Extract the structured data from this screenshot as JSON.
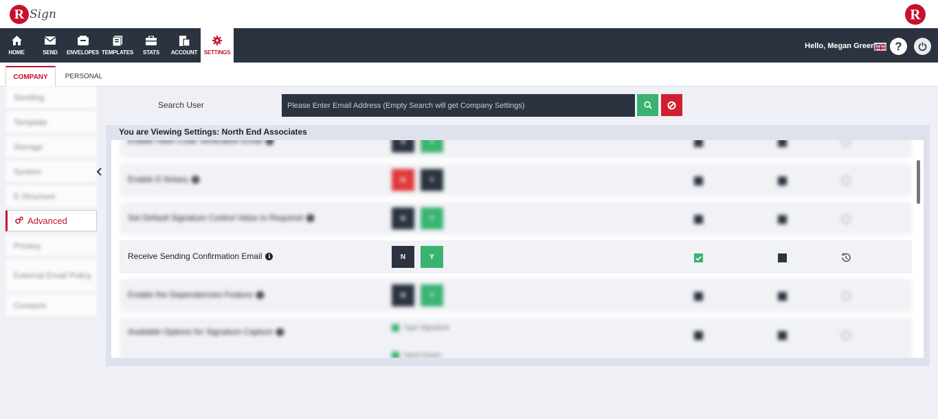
{
  "brand": {
    "logo_letter": "R",
    "logo_text": "Sign",
    "right_logo_letter": "R"
  },
  "nav": {
    "items": [
      {
        "label": "HOME",
        "icon": "home-icon"
      },
      {
        "label": "SEND",
        "icon": "envelope-icon"
      },
      {
        "label": "ENVELOPES",
        "icon": "inbox-icon"
      },
      {
        "label": "TEMPLATES",
        "icon": "templates-icon"
      },
      {
        "label": "STATS",
        "icon": "briefcase-icon"
      },
      {
        "label": "ACCOUNT",
        "icon": "account-icon"
      },
      {
        "label": "SETTINGS",
        "icon": "gear-icon",
        "active": true
      }
    ],
    "greeting_prefix": "Hello,",
    "user_name": "Megan Greene",
    "help_label": "?"
  },
  "tabs": {
    "company": "COMPANY",
    "personal": "PERSONAL"
  },
  "sidebar": {
    "items": [
      {
        "label": "Sending",
        "blurred": true
      },
      {
        "label": "Template",
        "blurred": true
      },
      {
        "label": "Storage",
        "blurred": true
      },
      {
        "label": "System",
        "blurred": true
      },
      {
        "label": "E-Structure",
        "blurred": true
      },
      {
        "label": "Advanced",
        "active": true
      },
      {
        "label": "Privacy",
        "blurred": true
      },
      {
        "label": "External Email Policy",
        "blurred": true
      },
      {
        "label": "Contacts",
        "blurred": true
      }
    ]
  },
  "search": {
    "label": "Search User",
    "placeholder": "Please Enter Email Address (Empty Search will get Company Settings)",
    "value": ""
  },
  "panel": {
    "title": "You are Viewing Settings: North End Associates"
  },
  "rows": [
    {
      "label": "Enable Hash Code Verification Email",
      "blurred": true,
      "n": "N",
      "y": "Y"
    },
    {
      "label": "Enable E-Notary",
      "blurred": true,
      "n": "N",
      "y": "Y"
    },
    {
      "label": "Set Default Signature Control Value to Required",
      "blurred": true,
      "n": "N",
      "y": "Y"
    },
    {
      "label": "Receive Sending Confirmation Email",
      "blurred": false,
      "n": "N",
      "y": "Y"
    },
    {
      "label": "Enable the Dependencies Feature",
      "blurred": true,
      "n": "N",
      "y": "Y"
    },
    {
      "label": "Available Options for Signature Capture",
      "blurred": true,
      "options": [
        "Type Signature",
        "Hand Drawn"
      ]
    }
  ],
  "colors": {
    "accent": "#c8102e",
    "nav_bg": "#2b3340",
    "green": "#3ab371",
    "red_button": "#d0202f"
  }
}
